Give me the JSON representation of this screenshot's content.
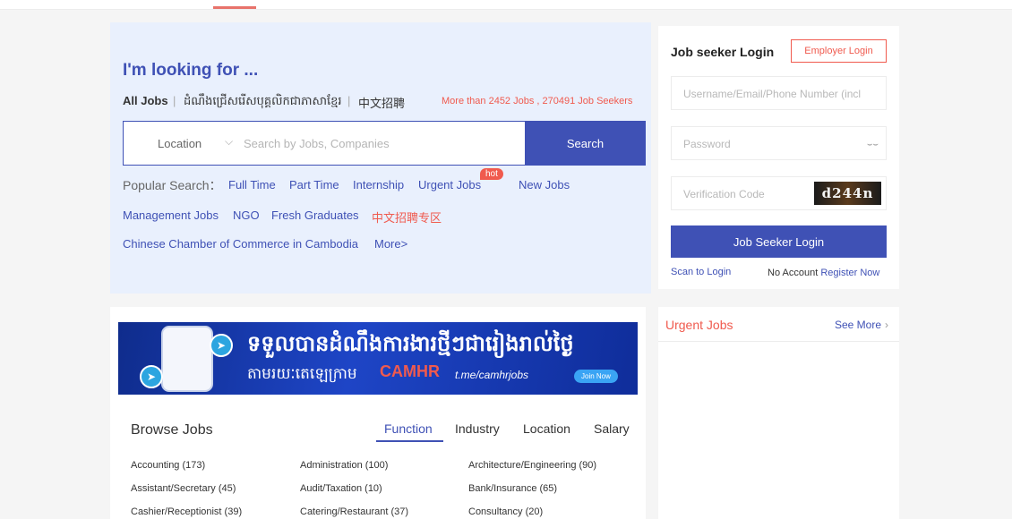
{
  "hero": {
    "title": "I'm looking for ...",
    "lang_all": "All Jobs",
    "lang_khmer": "ដំណឹងជ្រើសរើសបុគ្គលិកជាភាសាខ្មែរ",
    "lang_chinese": "中文招聘",
    "separator": "|",
    "stats": "More than 2452 Jobs , 270491 Job Seekers",
    "location_label": "Location",
    "search_placeholder": "Search by Jobs, Companies",
    "search_button": "Search",
    "popular_label": "Popular Search：",
    "popular": [
      "Full Time",
      "Part Time",
      "Internship",
      "Urgent Jobs",
      "New Jobs",
      "Management Jobs",
      "NGO",
      "Fresh Graduates",
      "中文招聘专区",
      "Chinese Chamber of Commerce in Cambodia",
      "More>"
    ],
    "hot_badge": "hot"
  },
  "login": {
    "title": "Job seeker Login",
    "employer_button": "Employer Login",
    "username_placeholder": "Username/Email/Phone Number (incl",
    "password_placeholder": "Password",
    "verification_placeholder": "Verification Code",
    "captcha_text": "d244n",
    "login_button": "Job Seeker Login",
    "scan_link": "Scan to Login",
    "no_account": "No Account",
    "register_link": "Register Now"
  },
  "banner": {
    "line1": "ទទួលបានដំណឹងការងារថ្មីៗជារៀងរាល់ថ្ងៃ",
    "line2": "តាមរយៈតេឡេក្រាម",
    "brand": "CAMHR",
    "url": "t.me/camhrjobs",
    "join": "Join Now"
  },
  "browse": {
    "title": "Browse Jobs",
    "tabs": [
      "Function",
      "Industry",
      "Location",
      "Salary"
    ],
    "categories": [
      "Accounting (173)",
      "Administration (100)",
      "Architecture/Engineering (90)",
      "Assistant/Secretary (45)",
      "Audit/Taxation (10)",
      "Bank/Insurance (65)",
      "Cashier/Receptionist (39)",
      "Catering/Restaurant (37)",
      "Consultancy (20)"
    ]
  },
  "urgent": {
    "title": "Urgent Jobs",
    "see_more": "See More"
  },
  "colors": {
    "primary": "#3f51b5",
    "accent_red": "#f05a4e",
    "hero_bg": "#e9f0fd"
  }
}
